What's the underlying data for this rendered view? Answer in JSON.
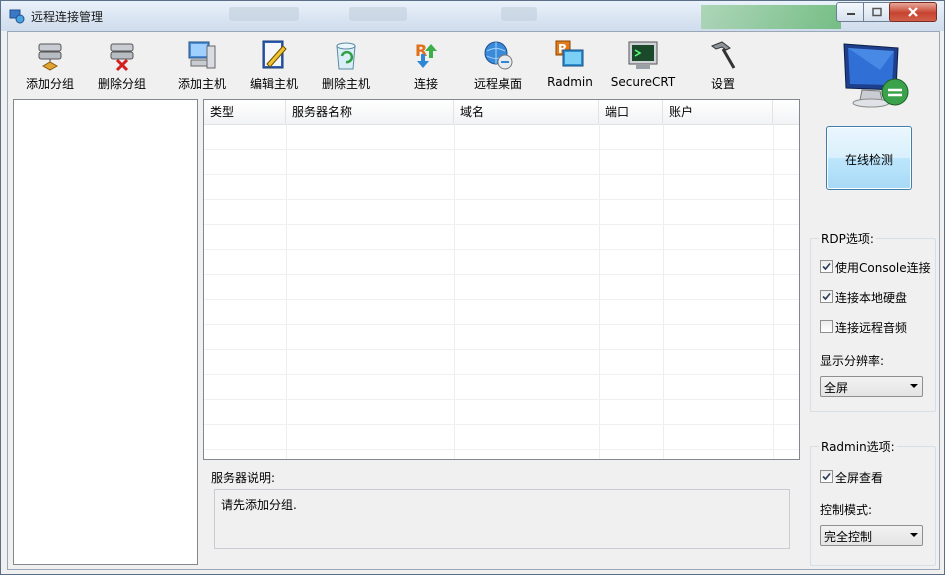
{
  "window": {
    "title": "远程连接管理"
  },
  "toolbar": {
    "items": [
      {
        "label": "添加分组",
        "icon": "add-group-icon"
      },
      {
        "label": "删除分组",
        "icon": "delete-group-icon"
      },
      {
        "label": "添加主机",
        "icon": "add-host-icon"
      },
      {
        "label": "编辑主机",
        "icon": "edit-host-icon"
      },
      {
        "label": "删除主机",
        "icon": "delete-host-icon"
      },
      {
        "label": "连接",
        "icon": "connect-icon"
      },
      {
        "label": "远程桌面",
        "icon": "remote-desktop-icon"
      },
      {
        "label": "Radmin",
        "icon": "radmin-icon"
      },
      {
        "label": "SecureCRT",
        "icon": "securecrt-icon"
      },
      {
        "label": "设置",
        "icon": "settings-hammer-icon"
      }
    ]
  },
  "grid": {
    "columns": [
      "类型",
      "服务器名称",
      "域名",
      "端口",
      "账户"
    ],
    "rows": []
  },
  "description": {
    "title": "服务器说明:",
    "text": "请先添加分组."
  },
  "side": {
    "check_button": "在线检测",
    "rdp": {
      "title": "RDP选项:",
      "options": [
        {
          "label": "使用Console连接",
          "checked": true
        },
        {
          "label": "连接本地硬盘",
          "checked": true
        },
        {
          "label": "连接远程音频",
          "checked": false
        }
      ],
      "resolution_label": "显示分辨率:",
      "resolution_value": "全屏"
    },
    "radmin": {
      "title": "Radmin选项:",
      "fullscreen_label": "全屏查看",
      "fullscreen_checked": true,
      "mode_label": "控制模式:",
      "mode_value": "完全控制"
    }
  },
  "colors": {
    "accent": "#3c7fb1",
    "close": "#c7432f"
  }
}
